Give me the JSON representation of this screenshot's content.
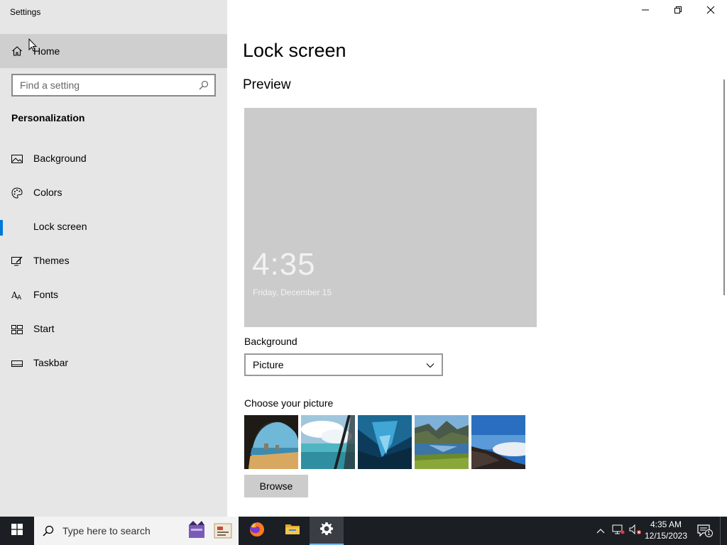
{
  "window": {
    "title": "Settings",
    "controls": [
      "minimize-icon",
      "restore-icon",
      "close-icon"
    ]
  },
  "sidebar": {
    "home_label": "Home",
    "search_placeholder": "Find a setting",
    "section": "Personalization",
    "items": [
      {
        "label": "Background",
        "icon": "picture-icon"
      },
      {
        "label": "Colors",
        "icon": "palette-icon"
      },
      {
        "label": "Lock screen",
        "icon": "lock-screen-icon",
        "active": true
      },
      {
        "label": "Themes",
        "icon": "themes-icon"
      },
      {
        "label": "Fonts",
        "icon": "fonts-icon"
      },
      {
        "label": "Start",
        "icon": "start-icon"
      },
      {
        "label": "Taskbar",
        "icon": "taskbar-icon"
      }
    ]
  },
  "main": {
    "title": "Lock screen",
    "preview_heading": "Preview",
    "preview_time": "4:35",
    "preview_date": "Friday, December 15",
    "background_label": "Background",
    "background_value": "Picture",
    "choose_label": "Choose your picture",
    "browse_label": "Browse"
  },
  "taskbar": {
    "search_text": "Type here to search",
    "clock_time": "4:35 AM",
    "clock_date": "12/15/2023",
    "notification_count": "1"
  },
  "colors": {
    "accent": "#0078d7",
    "sidebar_bg": "#e6e6e6",
    "taskbar_bg": "#1b1e22"
  }
}
